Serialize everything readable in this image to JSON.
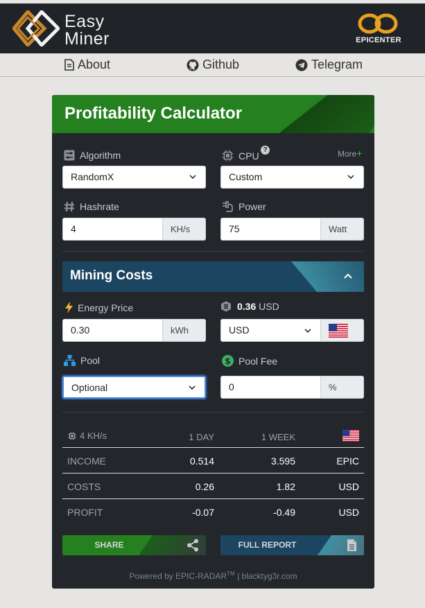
{
  "header": {
    "brand_line1": "Easy",
    "brand_line2": "Miner",
    "partner": "EPICENTER"
  },
  "nav": {
    "items": [
      {
        "label": "About",
        "icon": "document-icon"
      },
      {
        "label": "Github",
        "icon": "github-icon"
      },
      {
        "label": "Telegram",
        "icon": "telegram-icon"
      }
    ]
  },
  "calculator": {
    "title": "Profitability Calculator",
    "more_label": "More",
    "more_plus": "+",
    "algorithm": {
      "label": "Algorithm",
      "value": "RandomX"
    },
    "cpu": {
      "label": "CPU",
      "help": "?",
      "value": "Custom"
    },
    "hashrate": {
      "label": "Hashrate",
      "value": "4",
      "unit": "KH/s"
    },
    "power": {
      "label": "Power",
      "value": "75",
      "unit": "Watt"
    }
  },
  "mining_costs": {
    "title": "Mining Costs",
    "energy_price": {
      "label": "Energy Price",
      "value": "0.30",
      "unit": "kWh"
    },
    "coin_price": {
      "value": "0.36",
      "currency": "USD"
    },
    "currency": {
      "value": "USD",
      "flag": "us-flag-icon"
    },
    "pool": {
      "label": "Pool",
      "value": "Optional"
    },
    "pool_fee": {
      "label": "Pool Fee",
      "value": "0",
      "unit": "%"
    }
  },
  "results": {
    "header": {
      "hashrate": "4 KH/s",
      "day": "1 DAY",
      "week": "1 WEEK"
    },
    "rows": [
      {
        "name": "INCOME",
        "day": "0.514",
        "week": "3.595",
        "unit": "EPIC"
      },
      {
        "name": "COSTS",
        "day": "0.26",
        "week": "1.82",
        "unit": "USD"
      },
      {
        "name": "PROFIT",
        "day": "-0.07",
        "week": "-0.49",
        "unit": "USD"
      }
    ]
  },
  "actions": {
    "share": "SHARE",
    "report": "FULL REPORT"
  },
  "footer": {
    "powered": "Powered by",
    "radar": "EPIC-RADAR",
    "tm": "TM",
    "sep": "|",
    "site": "blacktyg3r.com"
  },
  "colors": {
    "header_bg": "#202327",
    "card_bg": "#23272c",
    "accent_green": "#25801f",
    "accent_blue": "#1b4560",
    "page_bg": "#e6e5e3"
  }
}
